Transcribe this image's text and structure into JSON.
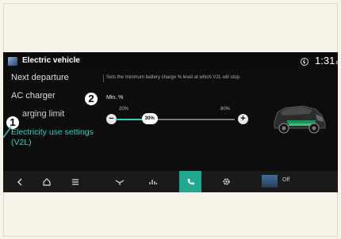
{
  "colors": {
    "accent": "#32d1b6",
    "active_bg": "#1fa98f",
    "screen_bg": "#0d0d0d",
    "page_bg": "#f7f3e8"
  },
  "header": {
    "title": "Electric vehicle",
    "time": "1:31",
    "time_suffix": "am",
    "status_icon": "charging-status-icon",
    "app_icon": "ev-app-icon"
  },
  "menu": {
    "items": [
      {
        "label": "Next departure"
      },
      {
        "label": "AC charger"
      },
      {
        "label": "arging limit"
      },
      {
        "label": "Electricity use settings (V2L)"
      }
    ]
  },
  "content": {
    "description": "Sets the minimum battery charge % level at which V2L will stop.",
    "min_label": "Min. %",
    "tick_min": "20%",
    "tick_max": "80%",
    "slider_value": "30%",
    "slider_range": [
      20,
      80
    ],
    "slider_level": 30,
    "decrease_label": "−",
    "increase_label": "+"
  },
  "annotations": [
    "1",
    "2"
  ],
  "bottom_bar": {
    "icons": [
      "back-icon",
      "home-icon",
      "menu-icon",
      "fan-icon",
      "equalizer-icon",
      "ev-phone-icon",
      "settings-icon"
    ],
    "media_text": "Off"
  }
}
